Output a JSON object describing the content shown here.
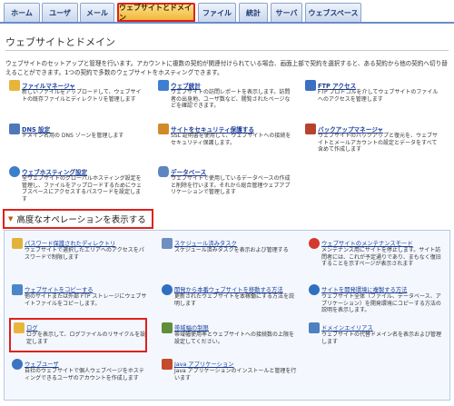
{
  "tabs": [
    {
      "label": "ホーム"
    },
    {
      "label": "ユーザ"
    },
    {
      "label": "メール"
    },
    {
      "label": "ウェブサイトとドメイン"
    },
    {
      "label": "ファイル"
    },
    {
      "label": "統計"
    },
    {
      "label": "サーバ"
    },
    {
      "label": "ウェブスペース"
    }
  ],
  "page": {
    "title": "ウェブサイトとドメイン",
    "intro": "ウェブサイトのセットアップと管理を行います。アカウントに複数の契約が関連付けられている場合、画面上部で契約を選択すると、ある契約から他の契約へ切り替えることができます。1つの契約で多数のウェブサイトをホスティングできます。"
  },
  "items": [
    {
      "title": "ファイルマネージャ",
      "desc": "新しいファイルをアップロードして、ウェブサイトの既存ファイルとディレクトリを管理します",
      "color": "#e7b53a",
      "icon": "folder-icon"
    },
    {
      "title": "ウェブ統計",
      "desc": "ウェブサイトの訪問レポートを表示します。訪問者の出身地、ユーザ数など、閲覧されたページなどを確認できます。",
      "color": "#3f7fd1",
      "icon": "chart-icon"
    },
    {
      "title": "FTP アクセス",
      "desc": "FTP プロトコルを介してウェブサイトのファイルへのアクセスを管理します",
      "color": "#3a6fc2",
      "icon": "ftp-icon"
    },
    {
      "title": "DNS 設定",
      "desc": "ドメイン名用の DNS ゾーンを管理します",
      "color": "#4e79b8",
      "icon": "dns-icon"
    },
    {
      "title": "サイトをセキュリティ保護する",
      "desc": "SSL 証明書を使用して、ウェブサイトへの接続をセキュリティ保護します。",
      "color": "#d18a2a",
      "icon": "lock-icon"
    },
    {
      "title": "バックアップマネージャ",
      "desc": "ウェブサイトのバックアップと復元を、ウェブサイトとメールアカウントの設定とデータをすべて含めて作成します",
      "color": "#b5432e",
      "icon": "backup-icon"
    },
    {
      "title": "ウェブホスティング設定",
      "desc": "全ウェブサイトのグローバルホスティング設定を管理し、ファイルをアップロードするためにウェブスペースにアクセスするパスワードを設定します",
      "color": "#3c7fc9",
      "icon": "globe-icon"
    },
    {
      "title": "データベース",
      "desc": "ウェブサイトで使用しているデータベースの作成と削除を行います。それから総合管理ウェブアプリケーションで管理します",
      "color": "#5b86c2",
      "icon": "database-icon"
    }
  ],
  "advanced": {
    "toggle_label": "高度なオペレーションを表示する",
    "items": [
      {
        "title": "パスワード保護されたディレクトリ",
        "desc": "ウェブサイトで選択したエリアへのアクセスをパスワードで制限します",
        "color": "#e2b33b",
        "icon": "folder-lock-icon"
      },
      {
        "title": "スケジュール済みタスク",
        "desc": "スケジュール済みタスクを表示および管理する",
        "color": "#6f8fbf",
        "icon": "calendar-icon"
      },
      {
        "title": "ウェブサイトのメンテナンスモード",
        "desc": "メンテナンス用にサイトを停止します。サイト訪問者には、これが予定通りであり、まもなく復旧することを示すページが表示されます",
        "color": "#d33a2c",
        "icon": "stop-icon"
      },
      {
        "title": "ウェブサイトをコピーする",
        "desc": "他のサイトまたは外部 FTP ストレージにウェブサイトファイルをコピーします。",
        "color": "#4b86c9",
        "icon": "copy-icon"
      },
      {
        "title": "開発から本番ウェブサイトを移動する方法",
        "desc": "更新されたウェブサイトを本稼働にする方法を説明します",
        "color": "#2f6fbf",
        "icon": "help-icon"
      },
      {
        "title": "サイトを開発環境に複製する方法",
        "desc": "ウェブサイト全体（ファイル、データベース、アプリケーション）を開発環境にコピーする方法の説明を表示します。",
        "color": "#2f6fbf",
        "icon": "help-icon"
      },
      {
        "title": "ログ",
        "desc": "ログを表示して、ログファイルのリサイクルを設定します",
        "color": "#e9b53c",
        "icon": "log-icon"
      },
      {
        "title": "帯域幅の制限",
        "desc": "帯域幅使用率とウェブサイトへの接続数の上限を設定してください。",
        "color": "#5f8f3a",
        "icon": "bandwidth-icon"
      },
      {
        "title": "ドメインエイリアス",
        "desc": "ウェブサイトの代替ドメイン名を表示および管理します",
        "color": "#4f7fbf",
        "icon": "alias-icon"
      },
      {
        "title": "ウェブユーザ",
        "desc": "自社のウェブサイトで個人ウェブページをホスティングできるユーザのアカウントを作成します",
        "color": "#3b74c0",
        "icon": "web-user-icon"
      },
      {
        "title": "Java アプリケーション",
        "desc": "Java アプリケーションのインストールと管理を行います",
        "color": "#c44b2b",
        "icon": "java-icon"
      }
    ]
  }
}
